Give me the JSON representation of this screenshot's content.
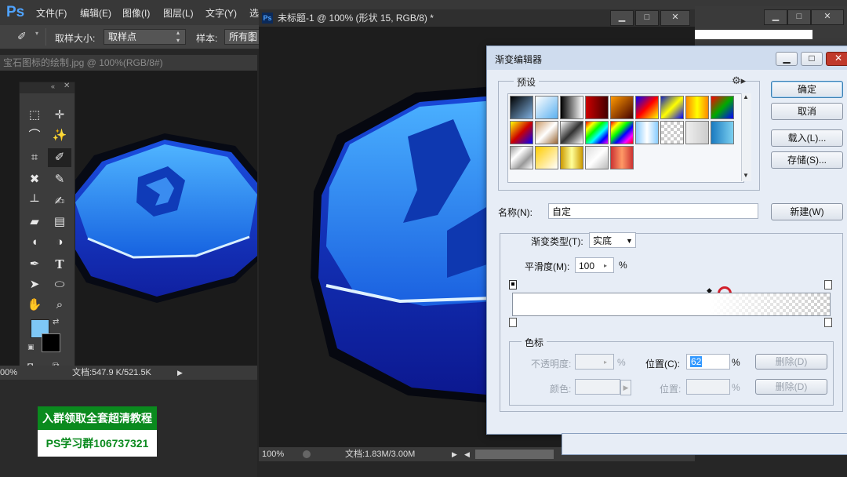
{
  "app": {
    "logo": "Ps"
  },
  "menu": [
    "文件(F)",
    "编辑(E)",
    "图像(I)",
    "图层(L)",
    "文字(Y)",
    "选"
  ],
  "options": {
    "sample_size_label": "取样大小:",
    "sample_size_value": "取样点",
    "sample_label": "样本:",
    "sample_value": "所有图"
  },
  "left_doc": {
    "tab": "宝石图标的绘制.jpg @ 100%(RGB/8#)",
    "zoom": "00%",
    "doc_info": "文档:547.9 K/521.5K"
  },
  "center_doc": {
    "ps_badge": "Ps",
    "title": "未标题-1 @ 100% (形状 15, RGB/8) *",
    "zoom": "100%",
    "doc_info": "文档:1.83M/3.00M"
  },
  "promo": {
    "line1": "入群领取全套超清教程",
    "line2": "PS学习群106737321"
  },
  "gradient_editor": {
    "title": "渐变编辑器",
    "presets_label": "预设",
    "buttons": {
      "ok": "确定",
      "cancel": "取消",
      "load": "载入(L)...",
      "save": "存储(S)...",
      "new": "新建(W)"
    },
    "name_label": "名称(N):",
    "name_value": "自定",
    "type_label": "渐变类型(T):",
    "type_value": "实底",
    "smooth_label": "平滑度(M):",
    "smooth_value": "100",
    "percent": "%",
    "stops_group": "色标",
    "opacity_label": "不透明度:",
    "color_label": "颜色:",
    "location_label": "位置(C):",
    "location_value": "62",
    "location2_label": "位置:",
    "delete_label": "删除(D)",
    "presets": [
      "linear-gradient(135deg,#000 0%,#7fb0e0 100%)",
      "linear-gradient(135deg,#fff,#5ab0f0)",
      "linear-gradient(90deg,#000,#fff)",
      "linear-gradient(90deg,#c00,#400)",
      "linear-gradient(135deg,#f90,#400)",
      "linear-gradient(135deg,#00f,#f00,#ff0)",
      "linear-gradient(135deg,#1020c0,#ff0,#00f)",
      "linear-gradient(90deg,#f80,#ff0,#f80)",
      "linear-gradient(135deg,#f00,#0a0,#00f)",
      "linear-gradient(135deg,#ff0,#c00,#00f)",
      "linear-gradient(135deg,#c96,#fff,#963)",
      "linear-gradient(135deg,#fff,#333,#fff)",
      "linear-gradient(135deg,#f00,#ff0,#0f0,#0ff,#00f,#f0f)",
      "linear-gradient(135deg,#f00,#ff0,#0f0,#00f,#f0f,#f00)",
      "linear-gradient(90deg,#8cf,#fff,#8cf)",
      "checker",
      "linear-gradient(90deg,#eee,#ccc)",
      "linear-gradient(90deg,#1a7ac0,#7cd0f0)",
      "linear-gradient(135deg,#999,#fff,#999,#fff)",
      "linear-gradient(135deg,#fc0,#fff)",
      "linear-gradient(90deg,#c90,#ff9,#c90)",
      "linear-gradient(135deg,#ddd,#fff,#bbb)",
      "linear-gradient(90deg,#c33,#f96,#c33)"
    ]
  },
  "colors": {
    "foreground": "#7ec7f5",
    "background": "#000000",
    "ps_blue": "#4fa3ff",
    "promo_green": "#0a8a1e"
  }
}
